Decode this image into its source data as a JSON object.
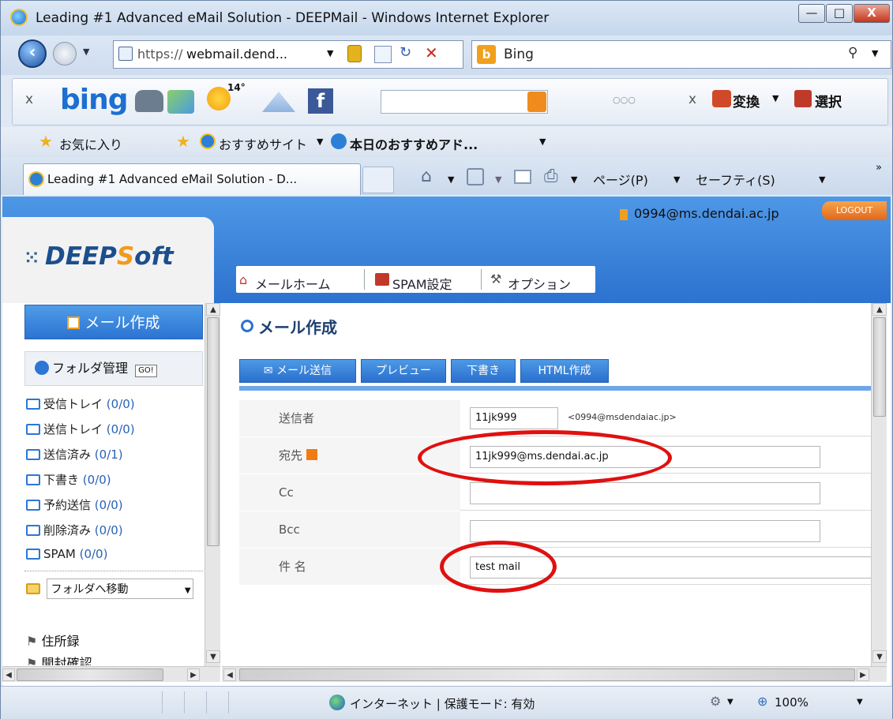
{
  "window": {
    "title": "Leading #1 Advanced eMail Solution - DEEPMail - Windows Internet Explorer",
    "min": "—",
    "max": "□",
    "close": "X"
  },
  "address": {
    "url_prefix": "https://",
    "url_rest": "webmail.dend...",
    "search_engine": "Bing"
  },
  "bingbar": {
    "close": "x",
    "logo": "bing",
    "temp": "14°",
    "more": "○○○",
    "close2": "x",
    "translate": "変換",
    "select": "選択"
  },
  "favorites": {
    "favorites_label": "お気に入り",
    "recommended_sites": "おすすめサイト",
    "today_addons": "本日のおすすめアド..."
  },
  "tabbar": {
    "tab_title": "Leading #1 Advanced eMail Solution - D...",
    "page_menu": "ページ(P)",
    "safety_menu": "セーフティ(S)",
    "more": "»"
  },
  "webmail": {
    "user_email": "0994@ms.dendai.ac.jp",
    "logout": "LOGOUT",
    "logo": {
      "prefix": "DEEP",
      "s": "S",
      "suffix": "oft"
    },
    "nav": {
      "home": "メールホーム",
      "spam": "SPAM設定",
      "options": "オプション"
    },
    "compose_button": "メール作成",
    "folder_manage": "フォルダ管理",
    "folder_go": "GO!",
    "folders": [
      {
        "name": "受信トレイ",
        "count": "(0/0)"
      },
      {
        "name": "送信トレイ",
        "count": "(0/0)"
      },
      {
        "name": "送信済み",
        "count": "(0/1)"
      },
      {
        "name": "下書き",
        "count": "(0/0)"
      },
      {
        "name": "予約送信",
        "count": "(0/0)"
      },
      {
        "name": "削除済み",
        "count": "(0/0)"
      },
      {
        "name": "SPAM",
        "count": "(0/0)"
      }
    ],
    "move_folder": "フォルダへ移動",
    "address_book": "住所録",
    "open_check": "開封確認",
    "page_heading": "メール作成",
    "toolbar": {
      "send": "メール送信",
      "preview": "プレビュー",
      "draft": "下書き",
      "html": "HTML作成"
    },
    "form": {
      "sender_label": "送信者",
      "sender_value": "11jk999",
      "sender_domain": "<0994@msdendaiac.jp>",
      "to_label": "宛先",
      "to_value": "11jk999@ms.dendai.ac.jp",
      "cc_label": "Cc",
      "cc_value": "",
      "bcc_label": "Bcc",
      "bcc_value": "",
      "subject_label": "件 名",
      "subject_value": "test mail"
    }
  },
  "statusbar": {
    "zone": "インターネット | 保護モード: 有効",
    "zoom": "100%"
  },
  "colors": {
    "accent_blue": "#2c72cf",
    "highlight_red": "#e01010",
    "logo_orange": "#f39a1b"
  }
}
